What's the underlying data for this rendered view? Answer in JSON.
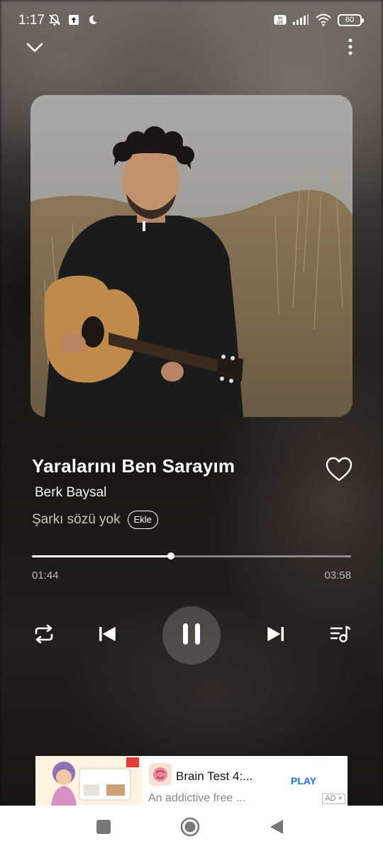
{
  "status_bar": {
    "time": "1:17",
    "battery": "60",
    "left_icons": [
      "bell-muted-icon",
      "upload-icon",
      "moon-icon"
    ],
    "right_icons": [
      "volte-icon",
      "signal-icon",
      "wifi-icon",
      "battery-icon"
    ]
  },
  "top_bar": {
    "collapse_icon": "chevron-down-icon",
    "menu_icon": "more-vertical-icon"
  },
  "song": {
    "title": "Yaralarını Ben Sarayım",
    "artist": "Berk Baysal",
    "lyrics_status": "Şarkı sözü yok",
    "add_label": "Ekle",
    "favorite_icon": "heart-outline-icon"
  },
  "playback": {
    "elapsed": "01:44",
    "total": "03:58",
    "progress_fraction": 0.436,
    "state": "playing",
    "controls": [
      "repeat-icon",
      "previous-icon",
      "pause-icon",
      "next-icon",
      "queue-icon"
    ]
  },
  "ad": {
    "title": "Brain Test 4:...",
    "description": "An addictive free ...",
    "cta": "PLAY",
    "badge": "AD ×"
  },
  "nav_bar": {
    "buttons": [
      "recents-icon",
      "home-icon",
      "back-icon"
    ]
  },
  "colors": {
    "accent": "#ffffff",
    "secondary_text": "#c9c6c2",
    "ad_cta": "#1a73e8"
  }
}
